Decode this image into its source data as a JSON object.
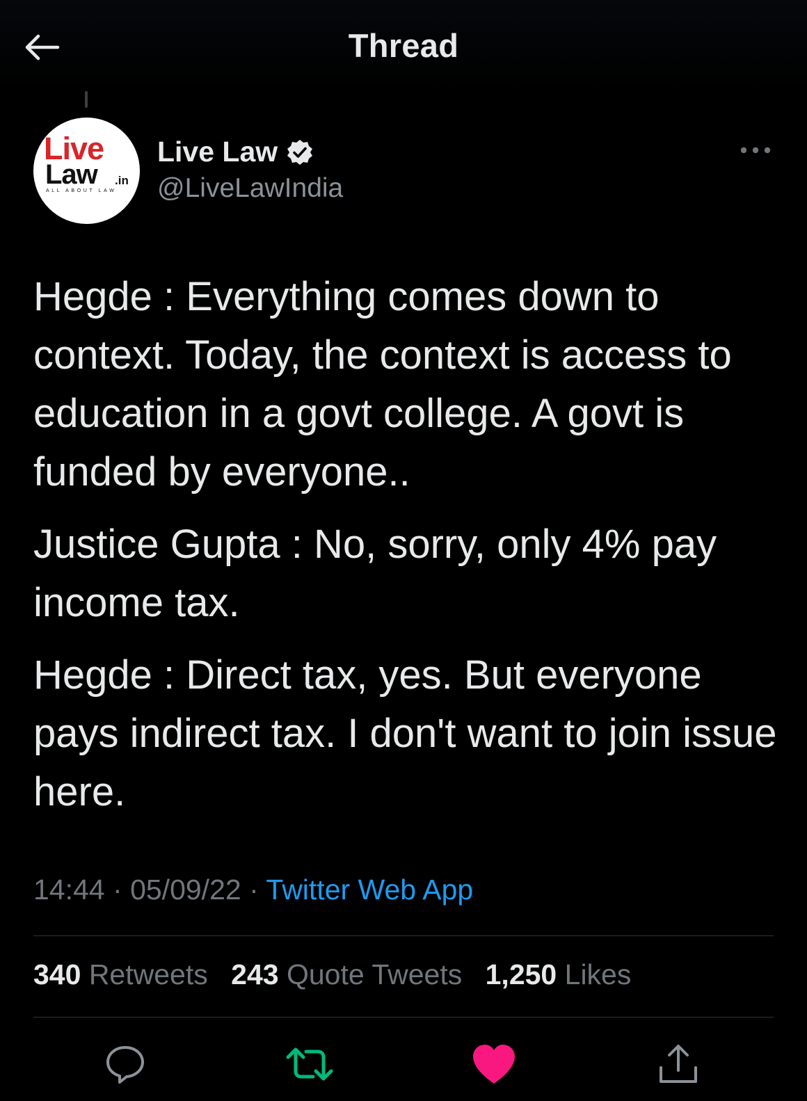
{
  "header": {
    "title": "Thread",
    "back_icon": "arrow-left-icon"
  },
  "author": {
    "avatar_logo": {
      "line1": "Live",
      "line2": "Law",
      "suffix": ".in",
      "tagline": "ALL ABOUT LAW"
    },
    "display_name": "Live Law",
    "verified_icon": "verified-badge-icon",
    "handle": "@LiveLawIndia",
    "more_icon": "ellipsis-icon"
  },
  "tweet": {
    "paragraphs": [
      "Hegde : Everything comes down to context. Today, the context is access to education in a govt college. A govt is funded by everyone..",
      "Justice Gupta : No, sorry, only 4% pay income tax.",
      "Hegde : Direct tax, yes. But everyone pays indirect tax. I don't want to join issue here."
    ],
    "time": "14:44",
    "separator": "·",
    "date": "05/09/22",
    "source": "Twitter Web App"
  },
  "stats": {
    "retweets_count": "340",
    "retweets_label": "Retweets",
    "quotes_count": "243",
    "quotes_label": "Quote Tweets",
    "likes_count": "1,250",
    "likes_label": "Likes"
  },
  "actions": {
    "reply_icon": "reply-bubble-icon",
    "retweet_icon": "retweet-icon",
    "like_icon": "heart-filled-icon",
    "share_icon": "share-icon"
  },
  "colors": {
    "background": "#000000",
    "text": "#e7e9ea",
    "muted": "#71767b",
    "link": "#1d9bf0",
    "retweet_active": "#00ba7c",
    "like_active": "#f91880",
    "logo_red": "#d9252a"
  }
}
